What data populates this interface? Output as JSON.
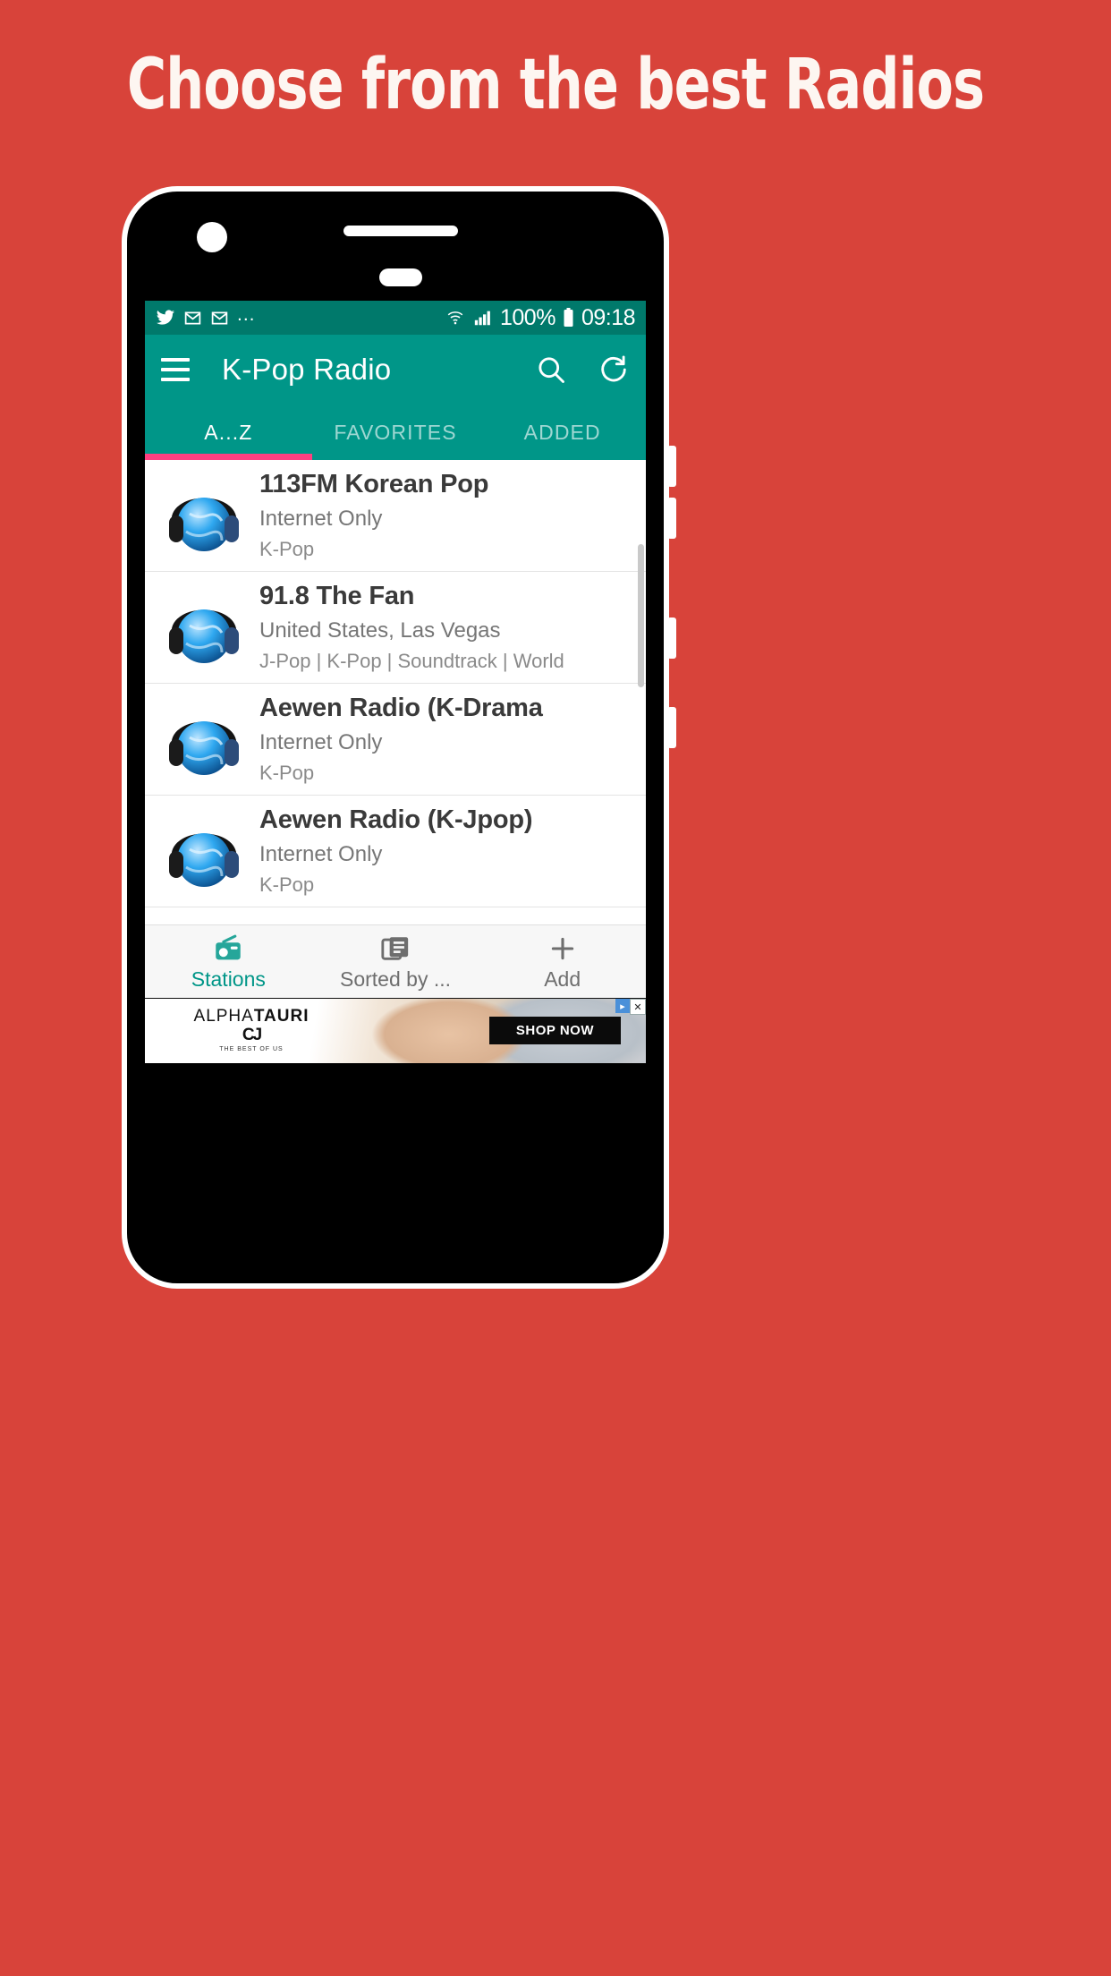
{
  "promo": {
    "headline": "Choose from the best Radios",
    "background_color": "#D8433A",
    "headline_color": "#FDF6F1"
  },
  "theme": {
    "status_bar_color": "#00796B",
    "app_bar_color": "#009688",
    "accent_color": "#FF4081",
    "active_nav_color": "#009688"
  },
  "status_bar": {
    "icons_left": [
      "twitter-icon",
      "gmail-icon",
      "gmail-icon"
    ],
    "overflow": "...",
    "wifi": "wifi-icon",
    "signal": "signal-icon",
    "battery_percent": "100%",
    "battery": "battery-icon",
    "time": "09:18"
  },
  "app_bar": {
    "menu_icon": "hamburger-icon",
    "title": "K-Pop Radio",
    "search_icon": "search-icon",
    "refresh_icon": "refresh-icon"
  },
  "tabs": [
    {
      "label": "A...Z",
      "active": true
    },
    {
      "label": "FAVORITES",
      "active": false
    },
    {
      "label": "ADDED",
      "active": false
    }
  ],
  "stations": [
    {
      "name": "113FM Korean Pop",
      "location": "Internet Only",
      "genre": "K-Pop",
      "icon": "globe-headphones-icon"
    },
    {
      "name": "91.8 The Fan",
      "location": "United States, Las Vegas",
      "genre": "J-Pop | K-Pop | Soundtrack | World",
      "icon": "globe-headphones-icon"
    },
    {
      "name": "Aewen Radio (K-Drama",
      "location": "Internet Only",
      "genre": "K-Pop",
      "icon": "globe-headphones-icon"
    },
    {
      "name": "Aewen Radio (K-Jpop)",
      "location": "Internet Only",
      "genre": "K-Pop",
      "icon": "globe-headphones-icon"
    }
  ],
  "bottom_nav": [
    {
      "label": "Stations",
      "icon": "radio-icon",
      "active": true
    },
    {
      "label": "Sorted by ...",
      "icon": "article-icon",
      "active": false
    },
    {
      "label": "Add",
      "icon": "plus-icon",
      "active": false
    }
  ],
  "ad": {
    "brand_light": "ALPHA",
    "brand_bold": "TAURI",
    "monogram": "CJ",
    "tagline": "THE BEST OF US",
    "cta": "SHOP NOW",
    "adchoices": "AdChoices",
    "close": "close-icon"
  }
}
